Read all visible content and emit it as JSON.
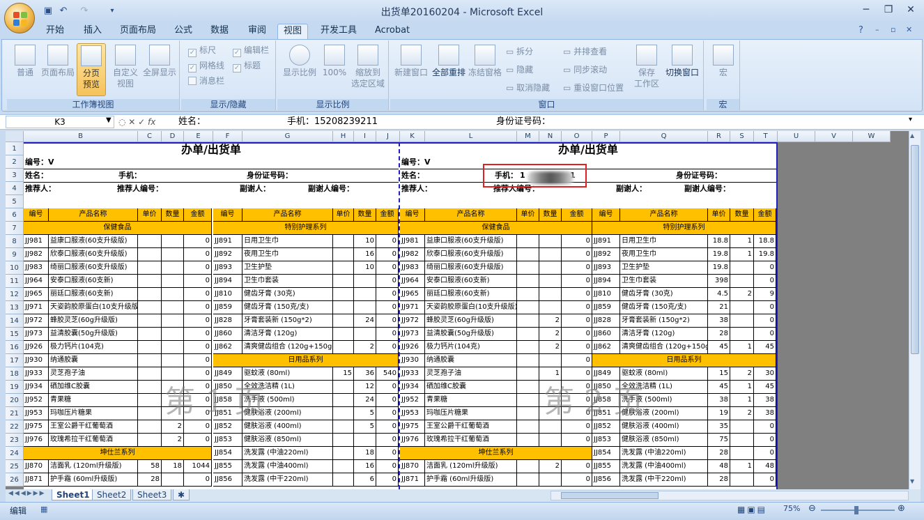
{
  "window": {
    "title": "出货单20160204 - Microsoft Excel"
  },
  "ribbon_tabs": [
    "开始",
    "插入",
    "页面布局",
    "公式",
    "数据",
    "审阅",
    "视图",
    "开发工具",
    "Acrobat"
  ],
  "active_tab": "视图",
  "groups": {
    "workbook_views": {
      "title": "工作簿视图",
      "buttons": [
        "普通",
        "页面布局",
        "分页\n预览",
        "自定义\n视图",
        "全屏显示"
      ]
    },
    "show_hide": {
      "title": "显示/隐藏",
      "items": [
        "标尺",
        "编辑栏",
        "网格线",
        "标题",
        "消息栏"
      ]
    },
    "zoom": {
      "title": "显示比例",
      "buttons": [
        "显示比例",
        "100%",
        "缩放到\n选定区域"
      ]
    },
    "window": {
      "title": "窗口",
      "buttons": [
        "新建窗口",
        "全部重排",
        "冻结窗格"
      ],
      "small": [
        "拆分",
        "隐藏",
        "取消隐藏",
        "并排查看",
        "同步滚动",
        "重设窗口位置"
      ],
      "buttons2": [
        "保存\n工作区",
        "切换窗口"
      ]
    },
    "macro": {
      "title": "宏",
      "buttons": [
        "宏"
      ]
    }
  },
  "formula_bar": {
    "name_box": "K3",
    "content": [
      "姓名：",
      "手机：15208239211",
      "身份证号码："
    ]
  },
  "columns": [
    "A",
    "B",
    "C",
    "D",
    "E",
    "F",
    "G",
    "H",
    "I",
    "J",
    "K",
    "L",
    "M",
    "N",
    "O",
    "P",
    "Q",
    "R",
    "S",
    "T",
    "U",
    "V",
    "W"
  ],
  "rows": [
    "1",
    "2",
    "3",
    "4",
    "5",
    "6",
    "7",
    "8",
    "9",
    "10",
    "11",
    "12",
    "13",
    "14",
    "15",
    "16",
    "17",
    "18",
    "19",
    "20",
    "21",
    "22",
    "23",
    "24",
    "25",
    "26"
  ],
  "sheet": {
    "title": "办单/出货单",
    "number_label": "编号：V",
    "name_label": "姓名：",
    "phone_label": "手机：",
    "phone_value_right": "1",
    "phone_value_right_end": "1",
    "id_label": "身份证号码：",
    "referrer": "推荐人：",
    "referrer_no": "推荐人编号：",
    "vice": "副谢人：",
    "vice_no": "副谢人编号：",
    "headers": [
      "编号",
      "产品名称",
      "单价",
      "数量",
      "金额"
    ],
    "cat_left_1": "保健食品",
    "cat_right_1": "特别护理系列",
    "cat_daily": "日用品系列",
    "cat_kun": "坤仕兰系列",
    "watermark_1": "第 1 页",
    "watermark_2": "第 2 页"
  },
  "left_products": [
    [
      "JJ981",
      "益康口服液(60支升级版)",
      "",
      "",
      "0"
    ],
    [
      "JJ982",
      "欣泰口服液(60支升级版)",
      "",
      "",
      "0"
    ],
    [
      "JJ983",
      "绮丽口服液(60支升级版)",
      "",
      "",
      "0"
    ],
    [
      "JJ964",
      "安泰口服液(60支新)",
      "",
      "",
      "0"
    ],
    [
      "JJ965",
      "丽廷口服液(60支新)",
      "",
      "",
      "0"
    ],
    [
      "JJ971",
      "天姿韵胶原蛋白(10支升级版)",
      "",
      "",
      "0"
    ],
    [
      "JJ972",
      "蜂胶灵芝(60g升级版)",
      "",
      "",
      "0"
    ],
    [
      "JJ973",
      "益清胶囊(50g升级版)",
      "",
      "",
      "0"
    ],
    [
      "JJ926",
      "极力钙片(104克)",
      "",
      "",
      "0"
    ],
    [
      "JJ930",
      "纳通胶囊",
      "",
      "",
      "0"
    ],
    [
      "JJ933",
      "灵芝孢子油",
      "",
      "",
      "0"
    ],
    [
      "JJ934",
      "硒加维C胶囊",
      "",
      "",
      "0"
    ],
    [
      "JJ952",
      "青果糖",
      "",
      "",
      "0"
    ],
    [
      "JJ953",
      "玛咖压片糖果",
      "",
      "",
      "0"
    ],
    [
      "JJ975",
      "王室公爵干红葡萄酒",
      "",
      "2",
      "0"
    ],
    [
      "JJ976",
      "玫瑰希拉干红葡萄酒",
      "",
      "2",
      "0"
    ]
  ],
  "left_kun": [
    [
      "JJ870",
      "洁面乳 (120ml升级版)",
      "58",
      "18",
      "1044"
    ],
    [
      "JJ871",
      "护手霜 (60ml升级版)",
      "28",
      "",
      "0"
    ]
  ],
  "mid_products": [
    [
      "JJ891",
      "日用卫生巾",
      "",
      "10",
      "0"
    ],
    [
      "JJ892",
      "夜用卫生巾",
      "",
      "16",
      "0"
    ],
    [
      "JJ893",
      "卫生护垫",
      "",
      "10",
      "0"
    ],
    [
      "JJ894",
      "卫生巾套装",
      "",
      "",
      "0"
    ],
    [
      "JJ810",
      "健齿牙膏 (30克)",
      "",
      "",
      "0"
    ],
    [
      "JJ859",
      "健齿牙膏 (150克/支)",
      "",
      "",
      "0"
    ],
    [
      "JJ828",
      "牙膏套装新 (150g*2)",
      "",
      "24",
      "0"
    ],
    [
      "JJ860",
      "清洁牙膏 (120g)",
      "",
      "",
      "0"
    ],
    [
      "JJ862",
      "清爽健齿组合 (120g+150g)",
      "",
      "2",
      "0"
    ]
  ],
  "mid_daily": [
    [
      "JJ849",
      "驱蚊液 (80ml)",
      "15",
      "36",
      "540"
    ],
    [
      "JJ850",
      "全效洗洁精 (1L)",
      "",
      "12",
      "0"
    ],
    [
      "JJ858",
      "洗手液 (500ml)",
      "",
      "24",
      "0"
    ],
    [
      "JJ851",
      "健肤浴液 (200ml)",
      "",
      "5",
      "0"
    ],
    [
      "JJ852",
      "健肤浴液 (400ml)",
      "",
      "5",
      "0"
    ],
    [
      "JJ853",
      "健肤浴液 (850ml)",
      "",
      "",
      "0"
    ],
    [
      "JJ854",
      "洗发露 (中油220ml)",
      "",
      "18",
      "0"
    ],
    [
      "JJ855",
      "洗发露 (中油400ml)",
      "",
      "16",
      "0"
    ],
    [
      "JJ856",
      "洗发露 (中干220ml)",
      "",
      "6",
      "0"
    ]
  ],
  "right_products": [
    [
      "JJ981",
      "益康口服液(60支升级版)",
      "",
      "",
      "0"
    ],
    [
      "JJ982",
      "欣泰口服液(60支升级版)",
      "",
      "",
      "0"
    ],
    [
      "JJ983",
      "绮丽口服液(60支升级版)",
      "",
      "",
      "0"
    ],
    [
      "JJ964",
      "安泰口服液(60支新)",
      "",
      "",
      "0"
    ],
    [
      "JJ965",
      "丽廷口服液(60支新)",
      "",
      "",
      "0"
    ],
    [
      "JJ971",
      "天姿韵胶原蛋白(10支升级版)",
      "",
      "",
      "0"
    ],
    [
      "JJ972",
      "蜂胶灵芝(60g升级版)",
      "",
      "2",
      "0"
    ],
    [
      "JJ973",
      "益清胶囊(50g升级版)",
      "",
      "2",
      "0"
    ],
    [
      "JJ926",
      "极力钙片(104克)",
      "",
      "2",
      "0"
    ],
    [
      "JJ930",
      "纳通胶囊",
      "",
      "",
      "0"
    ],
    [
      "JJ933",
      "灵芝孢子油",
      "",
      "1",
      "0"
    ],
    [
      "JJ934",
      "硒加维C胶囊",
      "",
      "",
      "0"
    ],
    [
      "JJ952",
      "青果糖",
      "",
      "",
      "0"
    ],
    [
      "JJ953",
      "玛咖压片糖果",
      "",
      "",
      "0"
    ],
    [
      "JJ975",
      "王室公爵干红葡萄酒",
      "",
      "",
      "0"
    ],
    [
      "JJ976",
      "玫瑰希拉干红葡萄酒",
      "",
      "",
      "0"
    ]
  ],
  "right_kun": [
    [
      "JJ870",
      "洁面乳 (120ml升级版)",
      "",
      "2",
      "0"
    ],
    [
      "JJ871",
      "护手霜 (60ml升级版)",
      "",
      "",
      "0"
    ]
  ],
  "far_products": [
    [
      "JJ891",
      "日用卫生巾",
      "18.8",
      "1",
      "18.8"
    ],
    [
      "JJ892",
      "夜用卫生巾",
      "19.8",
      "1",
      "19.8"
    ],
    [
      "JJ893",
      "卫生护垫",
      "19.8",
      "",
      "0"
    ],
    [
      "JJ894",
      "卫生巾套装",
      "398",
      "",
      "0"
    ],
    [
      "JJ810",
      "健齿牙膏 (30克)",
      "4.5",
      "2",
      "9"
    ],
    [
      "JJ859",
      "健齿牙膏 (150克/支)",
      "21",
      "",
      "0"
    ],
    [
      "JJ828",
      "牙膏套装新 (150g*2)",
      "38",
      "",
      "0"
    ],
    [
      "JJ860",
      "清洁牙膏 (120g)",
      "28",
      "",
      "0"
    ],
    [
      "JJ862",
      "清爽健齿组合 (120g+150g)",
      "45",
      "1",
      "45"
    ]
  ],
  "far_daily": [
    [
      "JJ849",
      "驱蚊液 (80ml)",
      "15",
      "2",
      "30"
    ],
    [
      "JJ850",
      "全效洗洁精 (1L)",
      "45",
      "1",
      "45"
    ],
    [
      "JJ858",
      "洗手液 (500ml)",
      "38",
      "1",
      "38"
    ],
    [
      "JJ851",
      "健肤浴液 (200ml)",
      "19",
      "2",
      "38"
    ],
    [
      "JJ852",
      "健肤浴液 (400ml)",
      "35",
      "",
      "0"
    ],
    [
      "JJ853",
      "健肤浴液 (850ml)",
      "75",
      "",
      "0"
    ],
    [
      "JJ854",
      "洗发露 (中油220ml)",
      "28",
      "",
      "0"
    ],
    [
      "JJ855",
      "洗发露 (中油400ml)",
      "48",
      "1",
      "48"
    ],
    [
      "JJ856",
      "洗发露 (中干220ml)",
      "28",
      "",
      "0"
    ]
  ],
  "sheet_tabs": [
    "Sheet1",
    "Sheet2",
    "Sheet3"
  ],
  "status": {
    "mode": "编辑",
    "zoom": "75%"
  }
}
